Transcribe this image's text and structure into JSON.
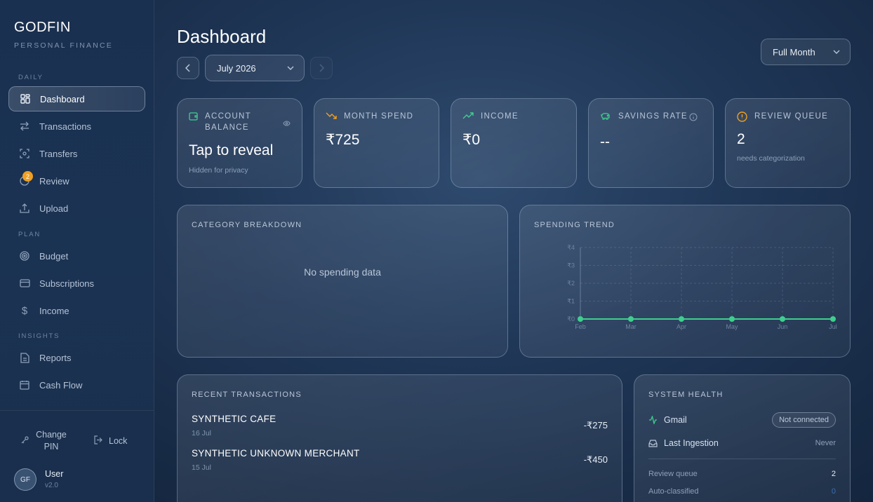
{
  "brand": {
    "name": "GODFIN",
    "subtitle": "PERSONAL FINANCE"
  },
  "sidebar": {
    "sections": {
      "daily": "DAILY",
      "plan": "PLAN",
      "insights": "INSIGHTS"
    },
    "items": [
      {
        "label": "Dashboard",
        "icon": "grid-icon"
      },
      {
        "label": "Transactions",
        "icon": "arrows-icon"
      },
      {
        "label": "Transfers",
        "icon": "scan-icon"
      },
      {
        "label": "Review",
        "icon": "review-icon",
        "badge": "2"
      },
      {
        "label": "Upload",
        "icon": "upload-icon"
      },
      {
        "label": "Budget",
        "icon": "target-icon"
      },
      {
        "label": "Subscriptions",
        "icon": "card-icon"
      },
      {
        "label": "Income",
        "icon": "dollar-icon"
      },
      {
        "label": "Reports",
        "icon": "document-icon"
      },
      {
        "label": "Cash Flow",
        "icon": "calendar-icon"
      }
    ],
    "footer": {
      "change_pin": "Change PIN",
      "lock": "Lock",
      "avatar": "GF",
      "user": "User",
      "version": "v2.0"
    }
  },
  "header": {
    "title": "Dashboard",
    "month": "July 2026",
    "period": "Full Month"
  },
  "stats": {
    "balance": {
      "label": "ACCOUNT BALANCE",
      "value": "Tap to reveal",
      "sub": "Hidden for privacy"
    },
    "spend": {
      "label": "MONTH SPEND",
      "value": "₹725"
    },
    "income": {
      "label": "INCOME",
      "value": "₹0"
    },
    "savings": {
      "label": "SAVINGS RATE",
      "value": "--"
    },
    "review": {
      "label": "REVIEW QUEUE",
      "value": "2",
      "sub": "needs categorization"
    }
  },
  "category": {
    "title": "CATEGORY BREAKDOWN",
    "empty": "No spending data"
  },
  "trend": {
    "title": "SPENDING TREND"
  },
  "chart_data": {
    "type": "line",
    "title": "SPENDING TREND",
    "categories": [
      "Feb",
      "Mar",
      "Apr",
      "May",
      "Jun",
      "Jul"
    ],
    "values": [
      0,
      0,
      0,
      0,
      0,
      0
    ],
    "yticks": [
      "₹0",
      "₹1",
      "₹2",
      "₹3",
      "₹4"
    ],
    "ylim": [
      0,
      4
    ],
    "grid": true,
    "color": "#3ecf8e"
  },
  "recent": {
    "title": "RECENT TRANSACTIONS",
    "rows": [
      {
        "name": "SYNTHETIC CAFE",
        "date": "16 Jul",
        "amount": "-₹275"
      },
      {
        "name": "SYNTHETIC UNKNOWN MERCHANT",
        "date": "15 Jul",
        "amount": "-₹450"
      }
    ]
  },
  "health": {
    "title": "SYSTEM HEALTH",
    "gmail": {
      "label": "Gmail",
      "status": "Not connected"
    },
    "ingestion": {
      "label": "Last Ingestion",
      "value": "Never"
    },
    "review_queue": {
      "label": "Review queue",
      "value": "2"
    },
    "auto": {
      "label": "Auto-classified",
      "value": "0"
    }
  },
  "colors": {
    "accent_green": "#3ecf8e",
    "warning": "#f0a020"
  }
}
